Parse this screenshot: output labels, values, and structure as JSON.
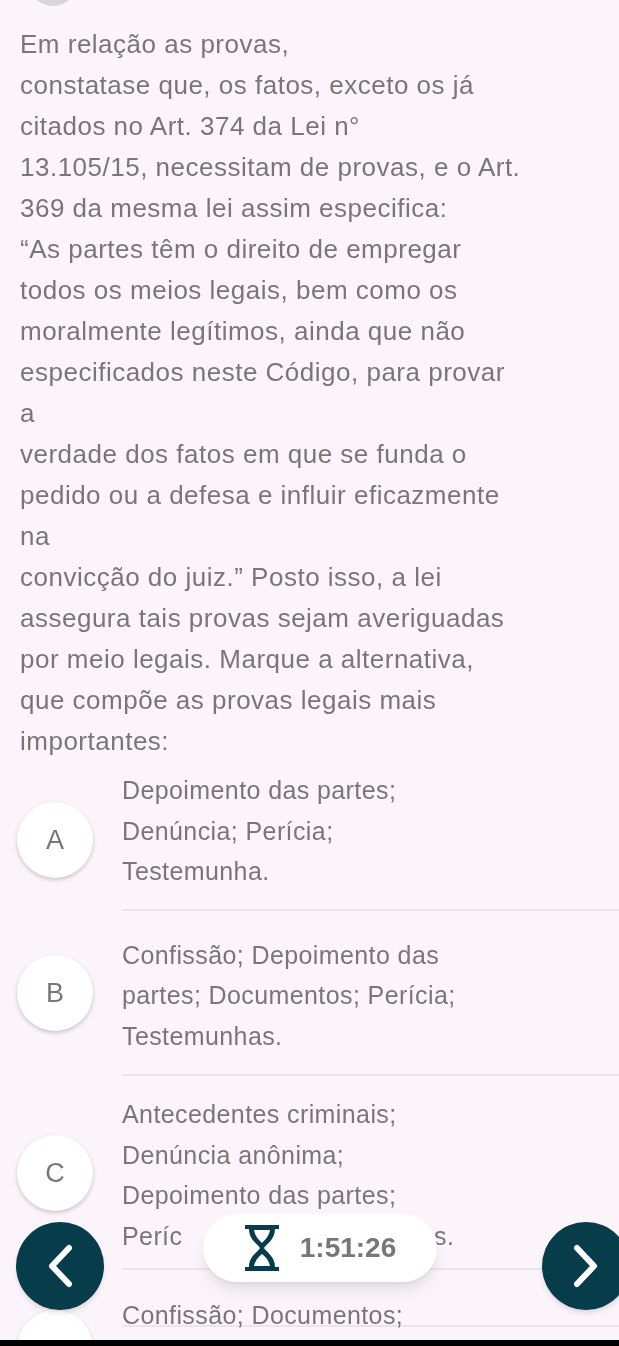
{
  "question": "Em relação as provas,\nconstatase que, os fatos, exceto os já\ncitados no Art. 374 da Lei n°\n13.105/15, necessitam de provas, e o Art.\n369 da mesma lei assim especifica:\n“As partes têm o direito de empregar\ntodos os meios legais, bem como os\nmoralmente legítimos, ainda que não\nespecificados neste Código, para provar\na\nverdade dos fatos em que se funda o\npedido ou a defesa e influir eficazmente\nna\nconvicção do juiz.” Posto isso, a lei\nassegura tais provas sejam averiguadas\npor meio legais. Marque a alternativa,\nque compõe as provas legais mais\nimportantes:",
  "options": [
    {
      "letter": "A",
      "lines": [
        "Depoimento das partes;\nDenúncia; Perícia;\nTestemunha."
      ]
    },
    {
      "letter": "B",
      "lines": [
        "Confissão; Depoimento das\npartes; Documentos; Perícia;\nTestemunhas."
      ]
    },
    {
      "letter": "C",
      "lines": [
        "Antecedentes criminais;",
        "Denúncia anônima;",
        "Depoimento das partes;"
      ],
      "covered_line": [
        "Períc",
        "s."
      ]
    },
    {
      "lines": [
        "Confissão; Documentos;"
      ]
    }
  ],
  "timer": {
    "time": "1:51:26"
  }
}
